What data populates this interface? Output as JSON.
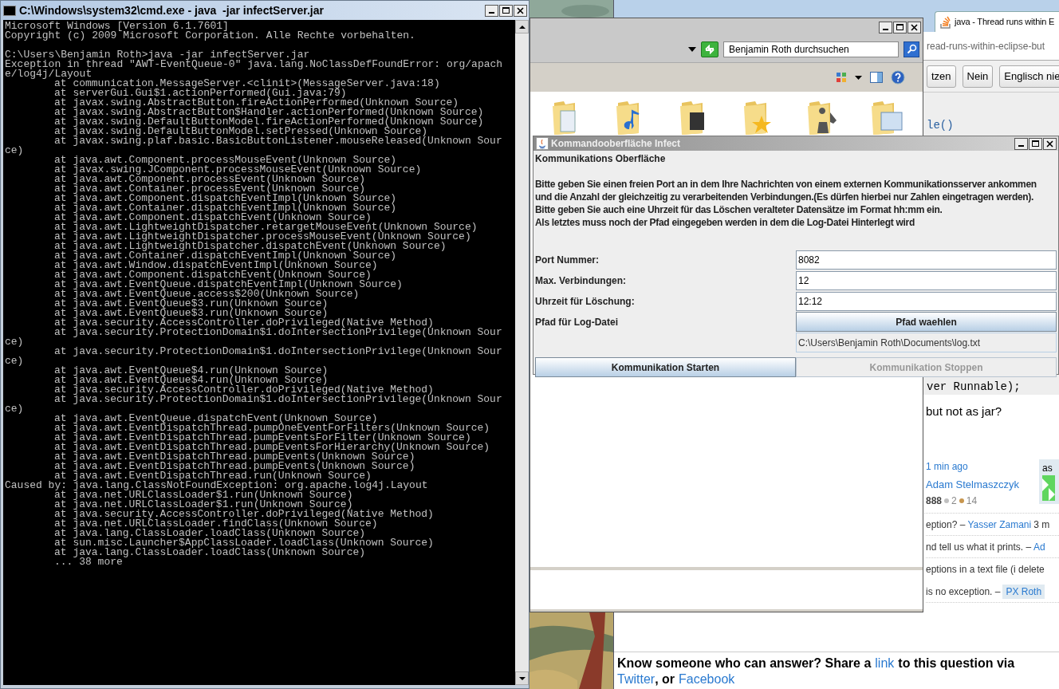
{
  "console": {
    "title": "C:\\Windows\\system32\\cmd.exe - java  -jar infectServer.jar",
    "blocks": [
      [
        {
          "text": "Microsoft Windows [Version 6.1.7601]",
          "kind": "text"
        },
        {
          "text": "Copyright (c) 2009 Microsoft Corporation. Alle Rechte vorbehalten.",
          "kind": "text"
        }
      ],
      [
        {
          "text": "C:\\Users\\Benjamin Roth>java -jar infectServer.jar",
          "kind": "text"
        },
        {
          "text": "Exception in thread \"AWT-EventQueue-0\" java.lang.NoClassDefFoundError: org/apach",
          "kind": "text"
        },
        {
          "text": "e/log4j/Layout",
          "kind": "text"
        },
        {
          "text": "at communication.MessageServer.<clinit>(MessageServer.java:18)",
          "kind": "frame"
        },
        {
          "text": "at serverGui.Gui$1.actionPerformed(Gui.java:79)",
          "kind": "frame"
        },
        {
          "text": "at javax.swing.AbstractButton.fireActionPerformed(Unknown Source)",
          "kind": "frame"
        },
        {
          "text": "at javax.swing.AbstractButton$Handler.actionPerformed(Unknown Source)",
          "kind": "frame"
        },
        {
          "text": "at javax.swing.DefaultButtonModel.fireActionPerformed(Unknown Source)",
          "kind": "frame"
        },
        {
          "text": "at javax.swing.DefaultButtonModel.setPressed(Unknown Source)",
          "kind": "frame"
        },
        {
          "text": "at javax.swing.plaf.basic.BasicButtonListener.mouseReleased(Unknown Sour",
          "kind": "frame"
        },
        {
          "text": "ce)",
          "kind": "text"
        },
        {
          "text": "at java.awt.Component.processMouseEvent(Unknown Source)",
          "kind": "frame"
        },
        {
          "text": "at javax.swing.JComponent.processMouseEvent(Unknown Source)",
          "kind": "frame"
        },
        {
          "text": "at java.awt.Component.processEvent(Unknown Source)",
          "kind": "frame"
        },
        {
          "text": "at java.awt.Container.processEvent(Unknown Source)",
          "kind": "frame"
        },
        {
          "text": "at java.awt.Component.dispatchEventImpl(Unknown Source)",
          "kind": "frame"
        },
        {
          "text": "at java.awt.Container.dispatchEventImpl(Unknown Source)",
          "kind": "frame"
        },
        {
          "text": "at java.awt.Component.dispatchEvent(Unknown Source)",
          "kind": "frame"
        },
        {
          "text": "at java.awt.LightweightDispatcher.retargetMouseEvent(Unknown Source)",
          "kind": "frame"
        },
        {
          "text": "at java.awt.LightweightDispatcher.processMouseEvent(Unknown Source)",
          "kind": "frame"
        },
        {
          "text": "at java.awt.LightweightDispatcher.dispatchEvent(Unknown Source)",
          "kind": "frame"
        },
        {
          "text": "at java.awt.Container.dispatchEventImpl(Unknown Source)",
          "kind": "frame"
        },
        {
          "text": "at java.awt.Window.dispatchEventImpl(Unknown Source)",
          "kind": "frame"
        },
        {
          "text": "at java.awt.Component.dispatchEvent(Unknown Source)",
          "kind": "frame"
        },
        {
          "text": "at java.awt.EventQueue.dispatchEventImpl(Unknown Source)",
          "kind": "frame"
        },
        {
          "text": "at java.awt.EventQueue.access$200(Unknown Source)",
          "kind": "frame"
        },
        {
          "text": "at java.awt.EventQueue$3.run(Unknown Source)",
          "kind": "frame"
        },
        {
          "text": "at java.awt.EventQueue$3.run(Unknown Source)",
          "kind": "frame"
        },
        {
          "text": "at java.security.AccessController.doPrivileged(Native Method)",
          "kind": "frame"
        },
        {
          "text": "at java.security.ProtectionDomain$1.doIntersectionPrivilege(Unknown Sour",
          "kind": "frame"
        },
        {
          "text": "ce)",
          "kind": "text"
        },
        {
          "text": "at java.security.ProtectionDomain$1.doIntersectionPrivilege(Unknown Sour",
          "kind": "frame"
        },
        {
          "text": "ce)",
          "kind": "text"
        },
        {
          "text": "at java.awt.EventQueue$4.run(Unknown Source)",
          "kind": "frame"
        },
        {
          "text": "at java.awt.EventQueue$4.run(Unknown Source)",
          "kind": "frame"
        },
        {
          "text": "at java.security.AccessController.doPrivileged(Native Method)",
          "kind": "frame"
        },
        {
          "text": "at java.security.ProtectionDomain$1.doIntersectionPrivilege(Unknown Sour",
          "kind": "frame"
        },
        {
          "text": "ce)",
          "kind": "text"
        },
        {
          "text": "at java.awt.EventQueue.dispatchEvent(Unknown Source)",
          "kind": "frame"
        },
        {
          "text": "at java.awt.EventDispatchThread.pumpOneEventForFilters(Unknown Source)",
          "kind": "frame"
        },
        {
          "text": "at java.awt.EventDispatchThread.pumpEventsForFilter(Unknown Source)",
          "kind": "frame"
        },
        {
          "text": "at java.awt.EventDispatchThread.pumpEventsForHierarchy(Unknown Source)",
          "kind": "frame"
        },
        {
          "text": "at java.awt.EventDispatchThread.pumpEvents(Unknown Source)",
          "kind": "frame"
        },
        {
          "text": "at java.awt.EventDispatchThread.pumpEvents(Unknown Source)",
          "kind": "frame"
        },
        {
          "text": "at java.awt.EventDispatchThread.run(Unknown Source)",
          "kind": "frame"
        },
        {
          "text": "Caused by: java.lang.ClassNotFoundException: org.apache.log4j.Layout",
          "kind": "text"
        },
        {
          "text": "at java.net.URLClassLoader$1.run(Unknown Source)",
          "kind": "frame"
        },
        {
          "text": "at java.net.URLClassLoader$1.run(Unknown Source)",
          "kind": "frame"
        },
        {
          "text": "at java.security.AccessController.doPrivileged(Native Method)",
          "kind": "frame"
        },
        {
          "text": "at java.net.URLClassLoader.findClass(Unknown Source)",
          "kind": "frame"
        },
        {
          "text": "at java.lang.ClassLoader.loadClass(Unknown Source)",
          "kind": "frame"
        },
        {
          "text": "at sun.misc.Launcher$AppClassLoader.loadClass(Unknown Source)",
          "kind": "frame"
        },
        {
          "text": "at java.lang.ClassLoader.loadClass(Unknown Source)",
          "kind": "frame"
        },
        {
          "text": "... 38 more",
          "kind": "frame"
        }
      ]
    ]
  },
  "explorer": {
    "search": {
      "placeholder": "Benjamin Roth durchsuchen"
    }
  },
  "dialog": {
    "title": "Kommandooberfläche Infect",
    "heading": "Kommunikations Oberfläche",
    "instructions": [
      "Bitte geben Sie einen freien Port an in dem Ihre Nachrichten von einem externen Kommunikationsserver ankommen",
      "und die Anzahl der gleichzeitig zu verarbeitenden Verbindungen.(Es dürfen hierbei nur Zahlen eingetragen werden).",
      "Bitte geben Sie auch eine Uhrzeit für das Löschen veralteter Datensätze im Format hh:mm ein.",
      "Als letztes muss noch der Pfad eingegeben werden in dem die Log-Datei Hinterlegt wird"
    ],
    "fields": [
      {
        "kind": "input",
        "label": "Port Nummer:",
        "value": "8082"
      },
      {
        "kind": "input",
        "label": "Max. Verbindungen:",
        "value": "12"
      },
      {
        "kind": "input",
        "label": "Uhrzeit für Löschung:",
        "value": "12:12"
      },
      {
        "kind": "button",
        "label": "Pfad für Log-Datei",
        "value": "Pfad waehlen"
      }
    ],
    "path": "C:\\Users\\Benjamin Roth\\Documents\\log.txt",
    "buttons": [
      {
        "label": "Kommunikation Starten",
        "disabled": false
      },
      {
        "label": "Kommunikation Stoppen",
        "disabled": true
      }
    ]
  },
  "browser": {
    "tab": {
      "title": "java - Thread runs within E",
      "selected": true
    },
    "url": "read-runs-within-eclipse-but",
    "translate_buttons": [
      "tzen",
      "Nein",
      "Englisch nie"
    ],
    "code": [
      "le()",
      "ver Runnable);"
    ],
    "question_tail": "but not as jar?",
    "asked": "1 min ago",
    "user": "Adam Stelmaszczyk",
    "reputation": "888",
    "silver": "2",
    "bronze": "14",
    "owner_label": "as",
    "comments": [
      {
        "parts": [
          {
            "text": "eption? –",
            "kind": "text"
          },
          {
            "text": "Yasser Zamani",
            "kind": "link"
          },
          {
            "text": "3 m",
            "kind": "text"
          }
        ]
      },
      {
        "parts": [
          {
            "text": "nd tell us what it prints. –",
            "kind": "text"
          },
          {
            "text": "Ad",
            "kind": "link"
          }
        ]
      },
      {
        "parts": [
          {
            "text": "eptions in a text file (i delete",
            "kind": "text"
          }
        ]
      },
      {
        "parts": [
          {
            "text": "is no exception. –",
            "kind": "text"
          },
          {
            "text": "PX Roth",
            "kind": "link"
          }
        ]
      }
    ],
    "share": {
      "before": "Know someone who can answer? Share a",
      "link": "link",
      "after": "to this question via",
      "line2": [
        {
          "text": "Twitter",
          "kind": "link"
        },
        {
          "text": ", or",
          "kind": "text"
        },
        {
          "text": "Facebook",
          "kind": "link"
        }
      ]
    }
  }
}
